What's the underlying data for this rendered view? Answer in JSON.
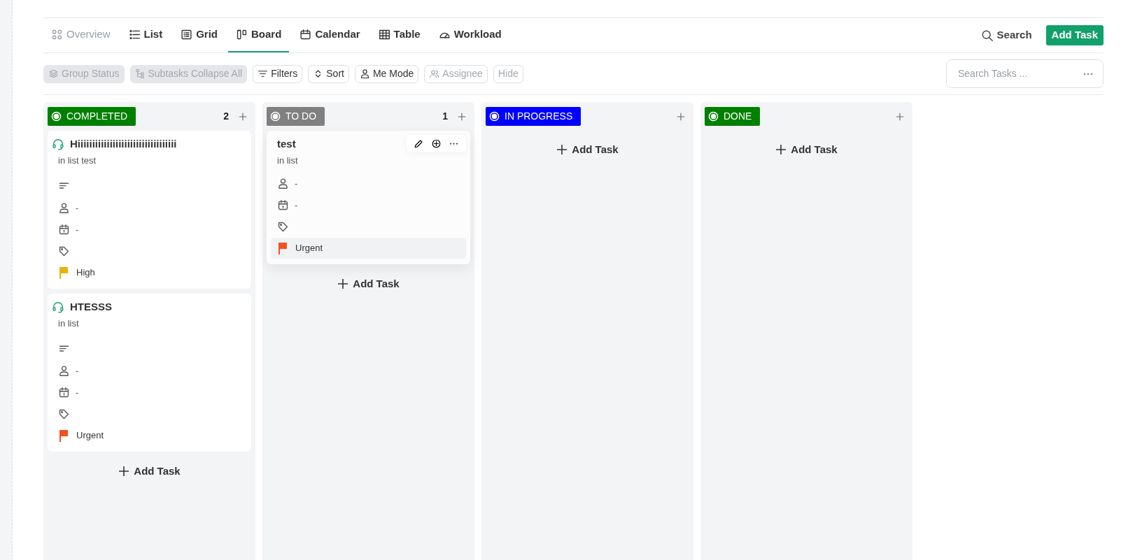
{
  "views": [
    {
      "label": "Overview",
      "selected": false,
      "disabled": true
    },
    {
      "label": "List",
      "selected": false,
      "disabled": false
    },
    {
      "label": "Grid",
      "selected": false,
      "disabled": false
    },
    {
      "label": "Board",
      "selected": true,
      "disabled": false
    },
    {
      "label": "Calendar",
      "selected": false,
      "disabled": false
    },
    {
      "label": "Table",
      "selected": false,
      "disabled": false
    },
    {
      "label": "Workload",
      "selected": false,
      "disabled": false
    }
  ],
  "search_label": "Search",
  "add_task_button": "Add Task",
  "toolbar": [
    {
      "label": "Group Status",
      "kind": "chip",
      "disabled": true
    },
    {
      "label": "Subtasks Collapse All",
      "kind": "chip",
      "disabled": true
    },
    {
      "label": "Filters",
      "kind": "outline",
      "disabled": false
    },
    {
      "label": "Sort",
      "kind": "outline",
      "disabled": false
    },
    {
      "label": "Me Mode",
      "kind": "outline",
      "disabled": false
    },
    {
      "label": "Assignee",
      "kind": "outline",
      "disabled": true
    },
    {
      "label": "Hide",
      "kind": "outline",
      "disabled": true
    }
  ],
  "search_tasks": {
    "placeholder": "Search Tasks ..."
  },
  "columns": [
    {
      "status": "COMPLETED",
      "color": "#008000",
      "count": "2",
      "add_task": "Add Task",
      "tasks": [
        {
          "title": "Hiiiiiiiiiiiiiiiiiiiiiiiiiiiiiiiiii",
          "headset_icon": true,
          "location": "in list test",
          "has_description": true,
          "assignee": "-",
          "due": "-",
          "priority": "High",
          "color": "#eab308",
          "hovered": false
        },
        {
          "title": "HTESSS",
          "headset_icon": true,
          "location": "in list",
          "has_description": true,
          "assignee": "-",
          "due": "-",
          "priority": "Urgent",
          "color": "#f4511e",
          "hovered": false
        }
      ]
    },
    {
      "status": "TO DO",
      "color": "#808080",
      "count": "1",
      "add_task": "Add Task",
      "tasks": [
        {
          "title": "test",
          "headset_icon": false,
          "location": "in list",
          "has_description": false,
          "assignee": "-",
          "due": "-",
          "priority": "Urgent",
          "color": "#f4511e",
          "hovered": true
        }
      ]
    },
    {
      "status": "IN PROGRESS",
      "color": "#0000ff",
      "add_task": "Add Task"
    },
    {
      "status": "DONE",
      "color": "#008000",
      "add_task": "Add Task"
    }
  ]
}
